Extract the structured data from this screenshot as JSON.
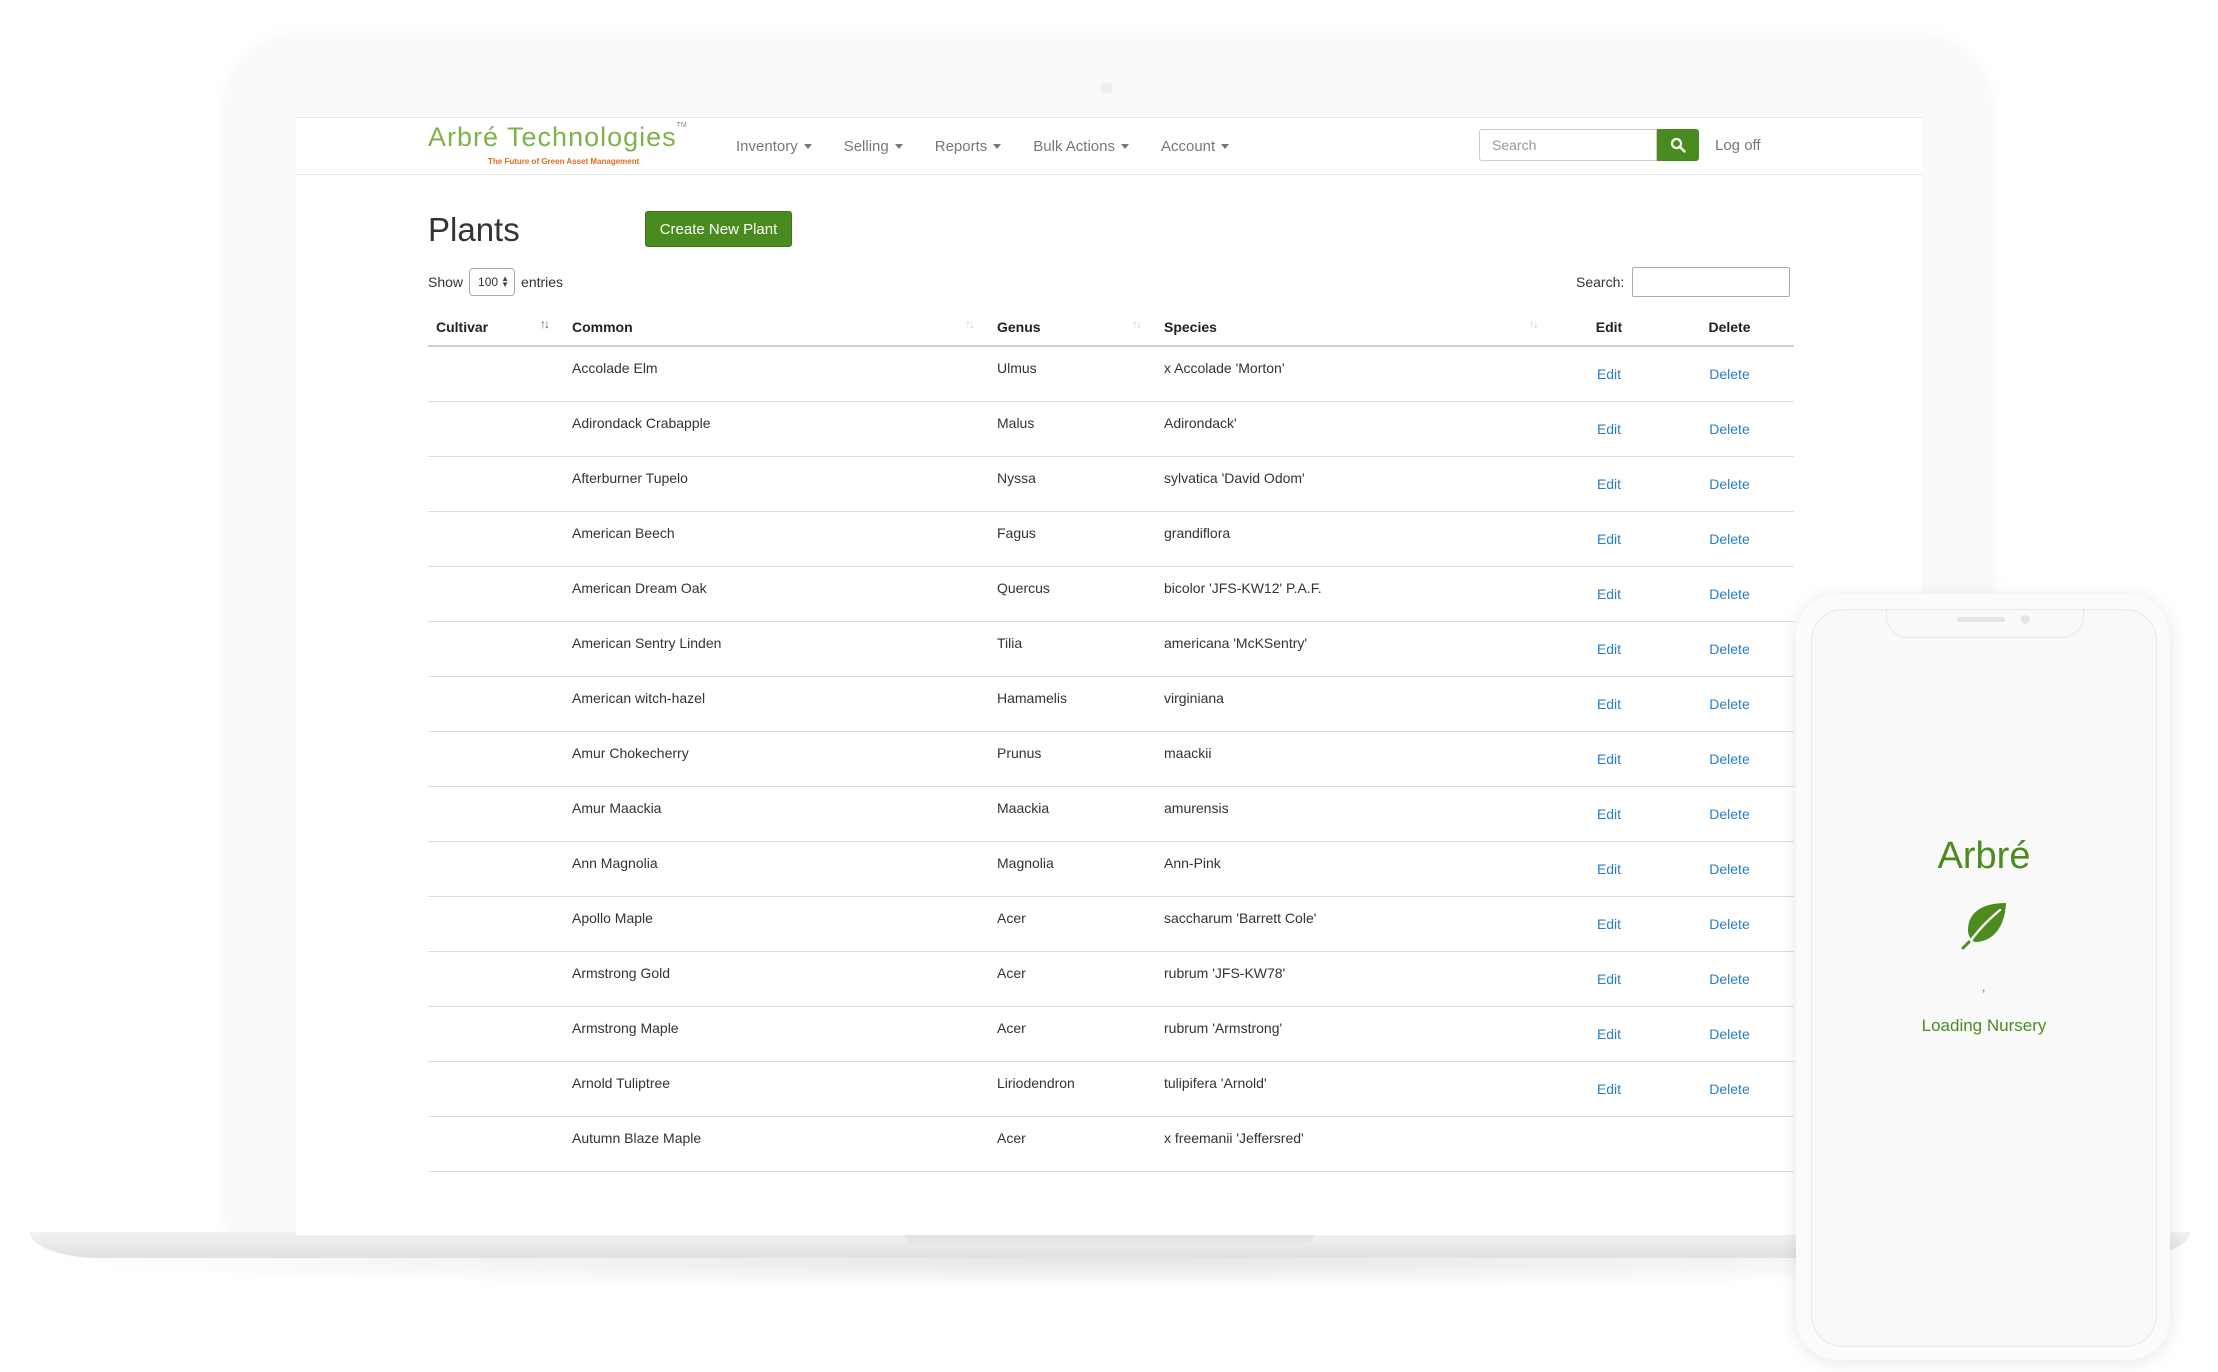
{
  "brand": {
    "name": "Arbré Technologies",
    "tm": "TM",
    "tagline": "The Future of Green Asset Management"
  },
  "nav": {
    "items": [
      "Inventory",
      "Selling",
      "Reports",
      "Bulk Actions",
      "Account"
    ],
    "search_placeholder": "Search",
    "logoff": "Log off"
  },
  "page": {
    "title": "Plants",
    "create_button": "Create New Plant",
    "show_label": "Show",
    "entries_value": "100",
    "entries_label": "entries",
    "search_label": "Search:"
  },
  "table": {
    "headers": [
      "Cultivar",
      "Common",
      "Genus",
      "Species",
      "Edit",
      "Delete"
    ],
    "rows": [
      {
        "cultivar": "",
        "common": "Accolade Elm",
        "genus": "Ulmus",
        "species": "x Accolade 'Morton'",
        "edit": "Edit",
        "delete": "Delete"
      },
      {
        "cultivar": "",
        "common": "Adirondack Crabapple",
        "genus": "Malus",
        "species": "Adirondack'",
        "edit": "Edit",
        "delete": "Delete"
      },
      {
        "cultivar": "",
        "common": "Afterburner Tupelo",
        "genus": "Nyssa",
        "species": "sylvatica 'David Odom'",
        "edit": "Edit",
        "delete": "Delete"
      },
      {
        "cultivar": "",
        "common": "American Beech",
        "genus": "Fagus",
        "species": "grandiflora",
        "edit": "Edit",
        "delete": "Delete"
      },
      {
        "cultivar": "",
        "common": "American Dream Oak",
        "genus": "Quercus",
        "species": "bicolor 'JFS-KW12' P.A.F.",
        "edit": "Edit",
        "delete": "Delete"
      },
      {
        "cultivar": "",
        "common": "American Sentry Linden",
        "genus": "Tilia",
        "species": "americana 'McKSentry'",
        "edit": "Edit",
        "delete": "Delete"
      },
      {
        "cultivar": "",
        "common": "American witch-hazel",
        "genus": "Hamamelis",
        "species": "virginiana",
        "edit": "Edit",
        "delete": "Delete"
      },
      {
        "cultivar": "",
        "common": "Amur Chokecherry",
        "genus": "Prunus",
        "species": "maackii",
        "edit": "Edit",
        "delete": "Delete"
      },
      {
        "cultivar": "",
        "common": "Amur Maackia",
        "genus": "Maackia",
        "species": "amurensis",
        "edit": "Edit",
        "delete": "Delete"
      },
      {
        "cultivar": "",
        "common": "Ann Magnolia",
        "genus": "Magnolia",
        "species": "Ann-Pink",
        "edit": "Edit",
        "delete": "Delete"
      },
      {
        "cultivar": "",
        "common": "Apollo Maple",
        "genus": "Acer",
        "species": "saccharum 'Barrett Cole'",
        "edit": "Edit",
        "delete": "Delete"
      },
      {
        "cultivar": "",
        "common": "Armstrong Gold",
        "genus": "Acer",
        "species": "rubrum 'JFS-KW78'",
        "edit": "Edit",
        "delete": "Delete"
      },
      {
        "cultivar": "",
        "common": "Armstrong Maple",
        "genus": "Acer",
        "species": "rubrum 'Armstrong'",
        "edit": "Edit",
        "delete": "Delete"
      },
      {
        "cultivar": "",
        "common": "Arnold Tuliptree",
        "genus": "Liriodendron",
        "species": "tulipifera 'Arnold'",
        "edit": "Edit",
        "delete": "Delete"
      },
      {
        "cultivar": "",
        "common": "Autumn Blaze Maple",
        "genus": "Acer",
        "species": "x freemanii 'Jeffersred'",
        "edit": "",
        "delete": ""
      }
    ]
  },
  "phone": {
    "title": "Arbré",
    "loading": "Loading Nursery"
  },
  "icons": {
    "search": "search-icon",
    "leaf": "leaf-icon",
    "caret": "caret-down-icon"
  },
  "colors": {
    "brand_green": "#7fb24a",
    "button_green": "#4a8b1f",
    "tagline_orange": "#e06b22",
    "link_blue": "#2a7ec4",
    "phone_green": "#4c8b1e"
  }
}
